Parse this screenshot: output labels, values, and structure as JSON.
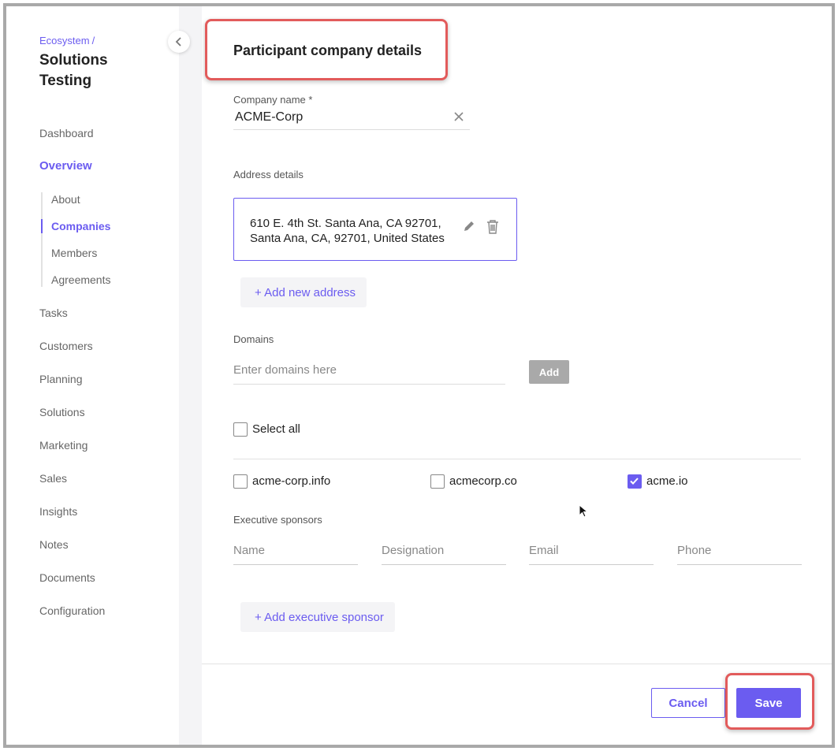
{
  "sidebar": {
    "breadcrumb": "Ecosystem",
    "breadcrumb_sep": "/",
    "title": "Solutions Testing",
    "nav": {
      "dashboard": "Dashboard",
      "overview": "Overview",
      "about": "About",
      "companies": "Companies",
      "members": "Members",
      "agreements": "Agreements",
      "tasks": "Tasks",
      "customers": "Customers",
      "planning": "Planning",
      "solutions": "Solutions",
      "marketing": "Marketing",
      "sales": "Sales",
      "insights": "Insights",
      "notes": "Notes",
      "documents": "Documents",
      "configuration": "Configuration"
    },
    "active_item": "Companies",
    "collapse_icon": "chevron-left-icon"
  },
  "main": {
    "title": "Participant company details",
    "company_name": {
      "label": "Company name *",
      "value": "ACME-Corp",
      "clear_icon": "close-icon"
    },
    "address": {
      "label": "Address details",
      "line1": "610 E. 4th St. Santa Ana, CA 92701,",
      "line2": "Santa Ana, CA, 92701, United States",
      "add_label": "+ Add new address"
    },
    "domains": {
      "label": "Domains",
      "placeholder": "Enter domains here",
      "add_button": "Add",
      "select_all": "Select all",
      "items": [
        {
          "name": "acme-corp.info",
          "checked": false
        },
        {
          "name": "acmecorp.co",
          "checked": false
        },
        {
          "name": "acme.io",
          "checked": true
        }
      ]
    },
    "sponsors": {
      "label": "Executive sponsors",
      "fields": {
        "name": "Name",
        "designation": "Designation",
        "email": "Email",
        "phone": "Phone"
      },
      "add_label": "+ Add executive sponsor"
    },
    "footer": {
      "cancel": "Cancel",
      "save": "Save"
    }
  },
  "colors": {
    "accent": "#6b5cf0",
    "highlight": "#e25b5b",
    "disabled_button": "#a9a9a9"
  }
}
